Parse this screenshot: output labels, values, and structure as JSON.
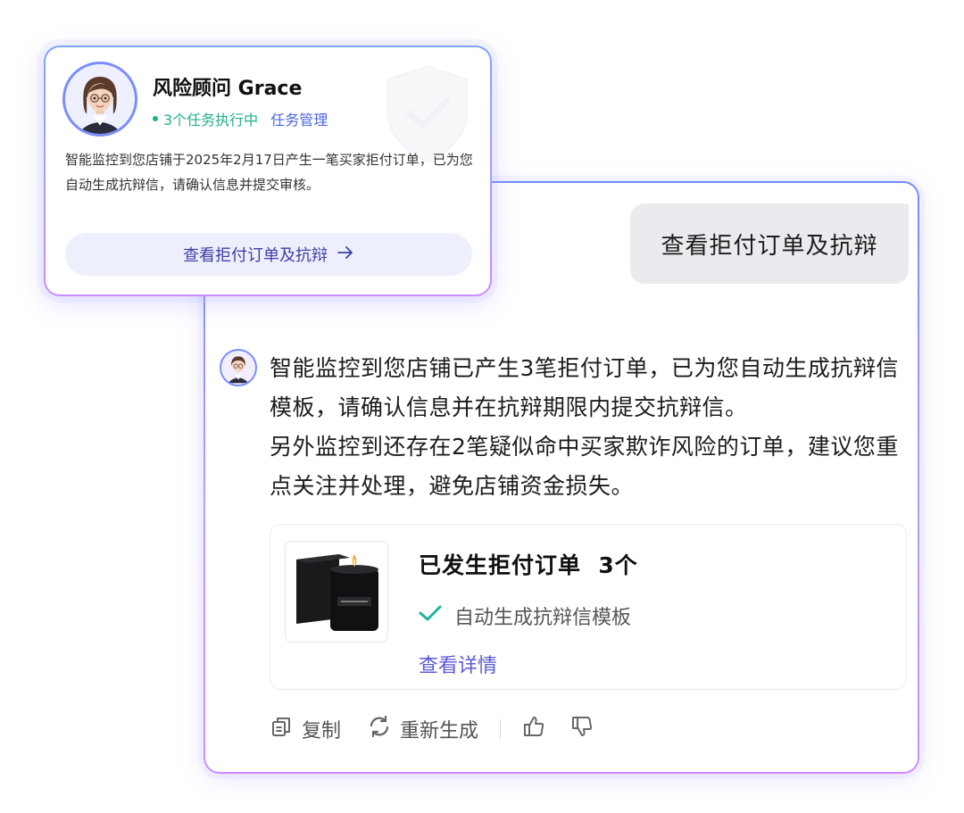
{
  "notification": {
    "advisor_name": "风险顾问 Grace",
    "status_text": "3个任务执行中",
    "task_link": "任务管理",
    "message": "智能监控到您店铺于2025年2月17日产生一笔买家拒付订单，已为您自动生成抗辩信，请确认信息并提交审核。",
    "button_label": "查看拒付订单及抗辩",
    "button_icon": "arrow-right-icon"
  },
  "chat": {
    "user_message": "查看拒付订单及抗辩",
    "bot_message_line1": "智能监控到您店铺已产生3笔拒付订单，已为您自动生成抗辩信模板，请确认信息并在抗辩期限内提交抗辩信。",
    "bot_message_line2": "另外监控到还存在2笔疑似命中买家欺诈风险的订单，建议您重点关注并处理，避免店铺资金损失。",
    "order_card": {
      "title": "已发生拒付订单  3个",
      "check_text": "自动生成抗辩信模板",
      "link_text": "查看详情"
    },
    "actions": {
      "copy": "复制",
      "regenerate": "重新生成"
    }
  },
  "colors": {
    "accent": "#5b5bd6",
    "status_green": "#22b08b",
    "check_teal": "#1fb39a"
  }
}
